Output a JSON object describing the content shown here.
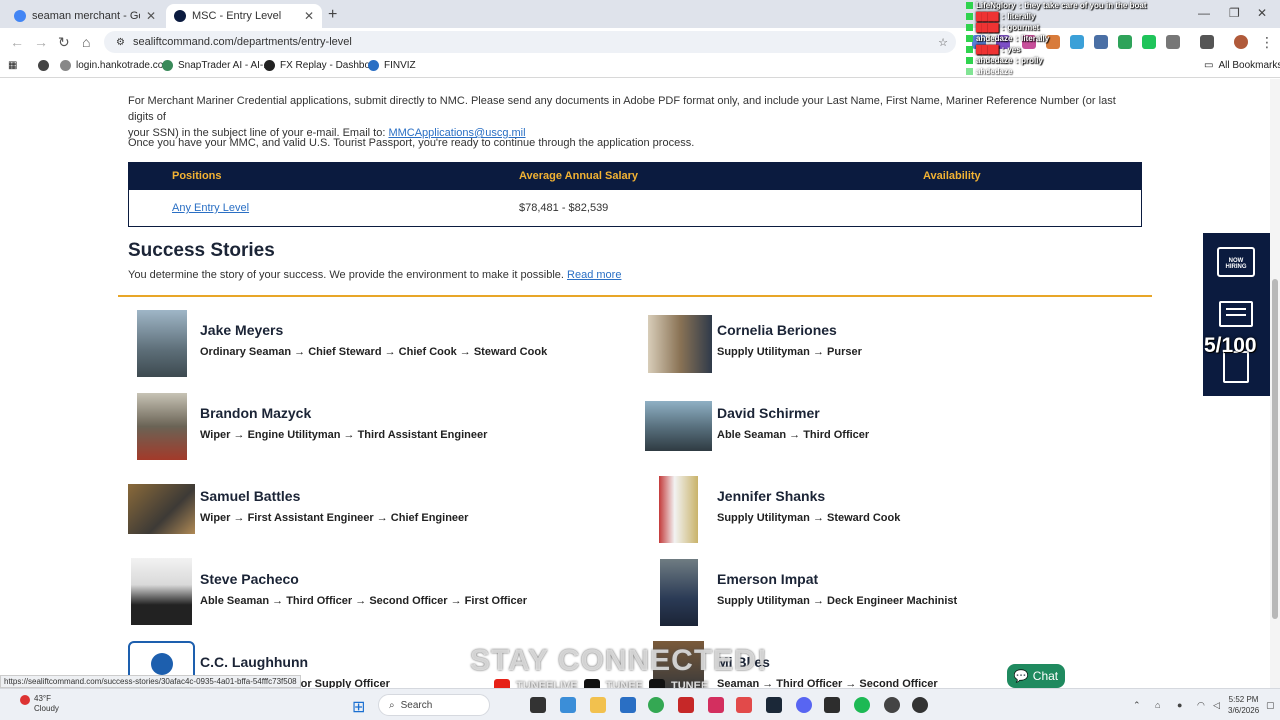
{
  "browser": {
    "tabs": [
      {
        "title": "seaman merchant - Google Sea",
        "active": false
      },
      {
        "title": "MSC - Entry Level",
        "active": true
      }
    ],
    "url": "sealiftcommand.com/departments/entry-level",
    "bookmarks": [
      "login.hankotrade.co...",
      "SnapTrader AI - AI-...",
      "FX Replay - Dashbo...",
      "FINVIZ",
      "All Bookmarks"
    ],
    "status_url": "https://sealiftcommand.com/success-stories/30afac4c-0935-4a01-bffa-54fffc73f508"
  },
  "page": {
    "intro_line1": "For Merchant Mariner Credential applications, submit directly to NMC. Please send any documents in Adobe PDF format only, and include your Last Name, First Name, Mariner Reference Number (or last digits of",
    "intro_line2": "your SSN) in the subject line of your e-mail. Email to:",
    "email_link": "MMCApplications@uscg.mil",
    "passport_line": "Once you have your MMC, and valid U.S. Tourist Passport, you're ready to continue through the application process.",
    "table": {
      "headers": [
        "Positions",
        "Average Annual Salary",
        "Availability"
      ],
      "rows": [
        {
          "position": "Any Entry Level",
          "salary": "$78,481 - $82,539",
          "availability": ""
        }
      ]
    },
    "success_title": "Success Stories",
    "success_sub": "You determine the story of your success. We provide the environment to make it possible.",
    "read_more": "Read more",
    "stories": [
      {
        "name": "Jake Meyers",
        "path": "Ordinary Seaman → Chief Steward → Chief Cook → Steward Cook"
      },
      {
        "name": "Cornelia Beriones",
        "path": "Supply Utilityman → Purser"
      },
      {
        "name": "Brandon Mazyck",
        "path": "Wiper → Engine Utilityman → Third Assistant Engineer"
      },
      {
        "name": "David Schirmer",
        "path": "Able Seaman → Third Officer"
      },
      {
        "name": "Samuel Battles",
        "path": "Wiper → First Assistant Engineer → Chief Engineer"
      },
      {
        "name": "Jennifer Shanks",
        "path": "Supply Utilityman → Steward Cook"
      },
      {
        "name": "Steve Pacheco",
        "path": "Able Seaman → Third Officer → Second Officer → First Officer"
      },
      {
        "name": "Emerson Impat",
        "path": "Supply Utilityman → Deck Engineer Machinist"
      },
      {
        "name": "C.C. Laughhunn",
        "path": "Junior Supply Officer"
      },
      {
        "name": "Mi     Bl  es",
        "path": "  Seaman → Third Officer → Second Officer"
      }
    ],
    "side_panel": {
      "now_hiring": "NOW HIRING"
    },
    "chat_button": "Chat"
  },
  "stream_overlay": {
    "counter": "5/100",
    "banner": "STAY CONNECTED!",
    "socials": [
      "TUNEELIVE",
      "TUNEE",
      "TUNEE"
    ],
    "chat": [
      {
        "user": "LifeNglory",
        "msg": "they take care of you in the boat"
      },
      {
        "user": "",
        "msg": "literally"
      },
      {
        "user": "",
        "msg": "gourmet"
      },
      {
        "user": "ahdedaze",
        "msg": "literally"
      },
      {
        "user": "",
        "msg": "yes"
      },
      {
        "user": "ahdedaze",
        "msg": "prolly"
      },
      {
        "user": "ahdedaze",
        "msg": ""
      }
    ]
  },
  "taskbar": {
    "weather_temp": "43°F",
    "weather_desc": "Cloudy",
    "search": "Search",
    "time": "5:52 PM",
    "date": "3/6/2026"
  }
}
